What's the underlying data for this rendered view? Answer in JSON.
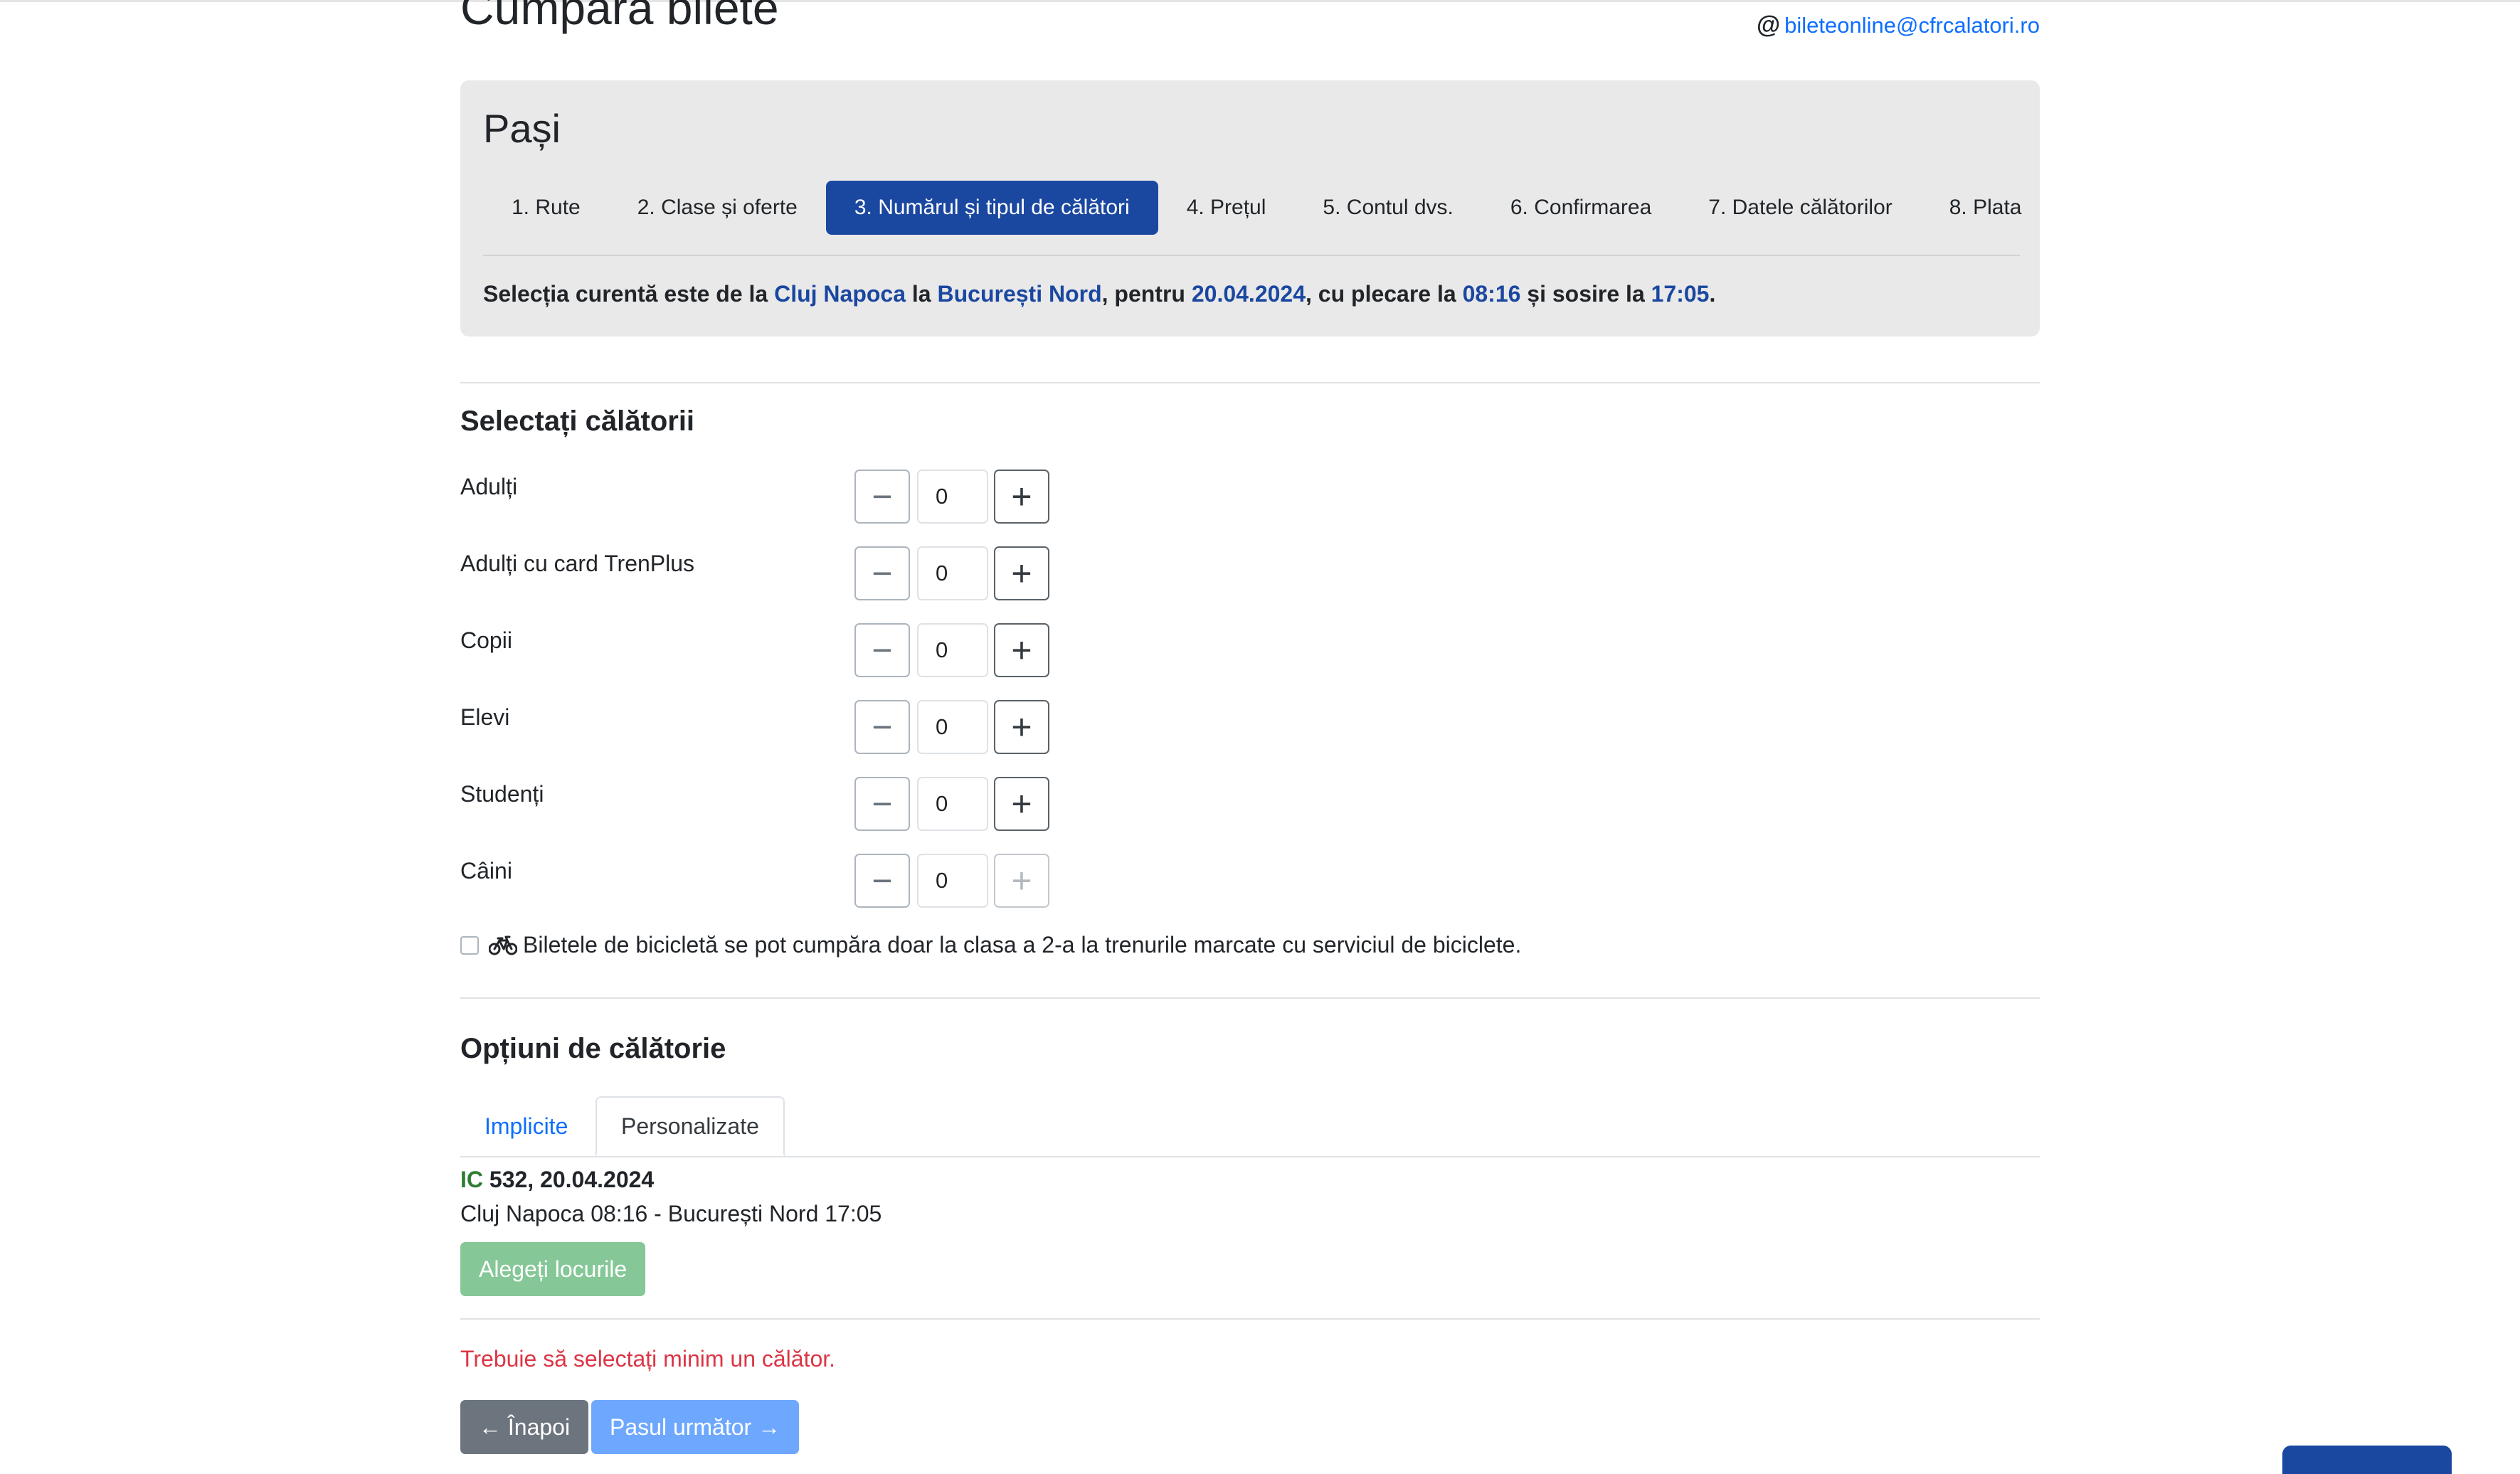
{
  "header": {
    "title": "Cumpără bilete",
    "email": "bileteonline@cfrcalatori.ro"
  },
  "steps": {
    "title": "Pași",
    "items": [
      {
        "label": "1. Rute"
      },
      {
        "label": "2. Clase și oferte"
      },
      {
        "label": "3. Numărul și tipul de călători"
      },
      {
        "label": "4. Prețul"
      },
      {
        "label": "5. Contul dvs."
      },
      {
        "label": "6. Confirmarea"
      },
      {
        "label": "7. Datele călătorilor"
      },
      {
        "label": "8. Plata"
      }
    ],
    "active_index": 2
  },
  "selection": {
    "p1": "Selecția curentă este de la ",
    "from": "Cluj Napoca",
    "p2": " la ",
    "to": "București Nord",
    "p3": ", pentru ",
    "date": "20.04.2024",
    "p4": ", cu plecare la ",
    "departure": "08:16",
    "p5": " și sosire la ",
    "arrival": "17:05",
    "p6": "."
  },
  "travelers": {
    "title": "Selectați călătorii",
    "rows": [
      {
        "label": "Adulți",
        "value": "0"
      },
      {
        "label": "Adulți cu card TrenPlus",
        "value": "0"
      },
      {
        "label": "Copii",
        "value": "0"
      },
      {
        "label": "Elevi",
        "value": "0"
      },
      {
        "label": "Studenți",
        "value": "0"
      },
      {
        "label": "Câini",
        "value": "0"
      }
    ],
    "minus_symbol": "−",
    "plus_symbol": "+",
    "bike_note": "Biletele de bicicletă se pot cumpăra doar la clasa a 2-a la trenurile marcate cu serviciul de biciclete."
  },
  "options": {
    "title": "Opțiuni de călătorie",
    "tabs": [
      "Implicite",
      "Personalizate"
    ],
    "train": {
      "type": "IC",
      "number_date": " 532, 20.04.2024",
      "route": "Cluj Napoca 08:16 - București Nord 17:05"
    },
    "choose_seats": "Alegeți locurile"
  },
  "error": "Trebuie să selectați minim un călător.",
  "buttons": {
    "back": "Înapoi",
    "next": "Pasul următor"
  },
  "colors": {
    "primary": "#1a47a0",
    "link": "#0d6efd",
    "error": "#dc3545",
    "success_disabled": "#85c797",
    "next_disabled": "#6ea8fe",
    "secondary": "#6c757d"
  }
}
